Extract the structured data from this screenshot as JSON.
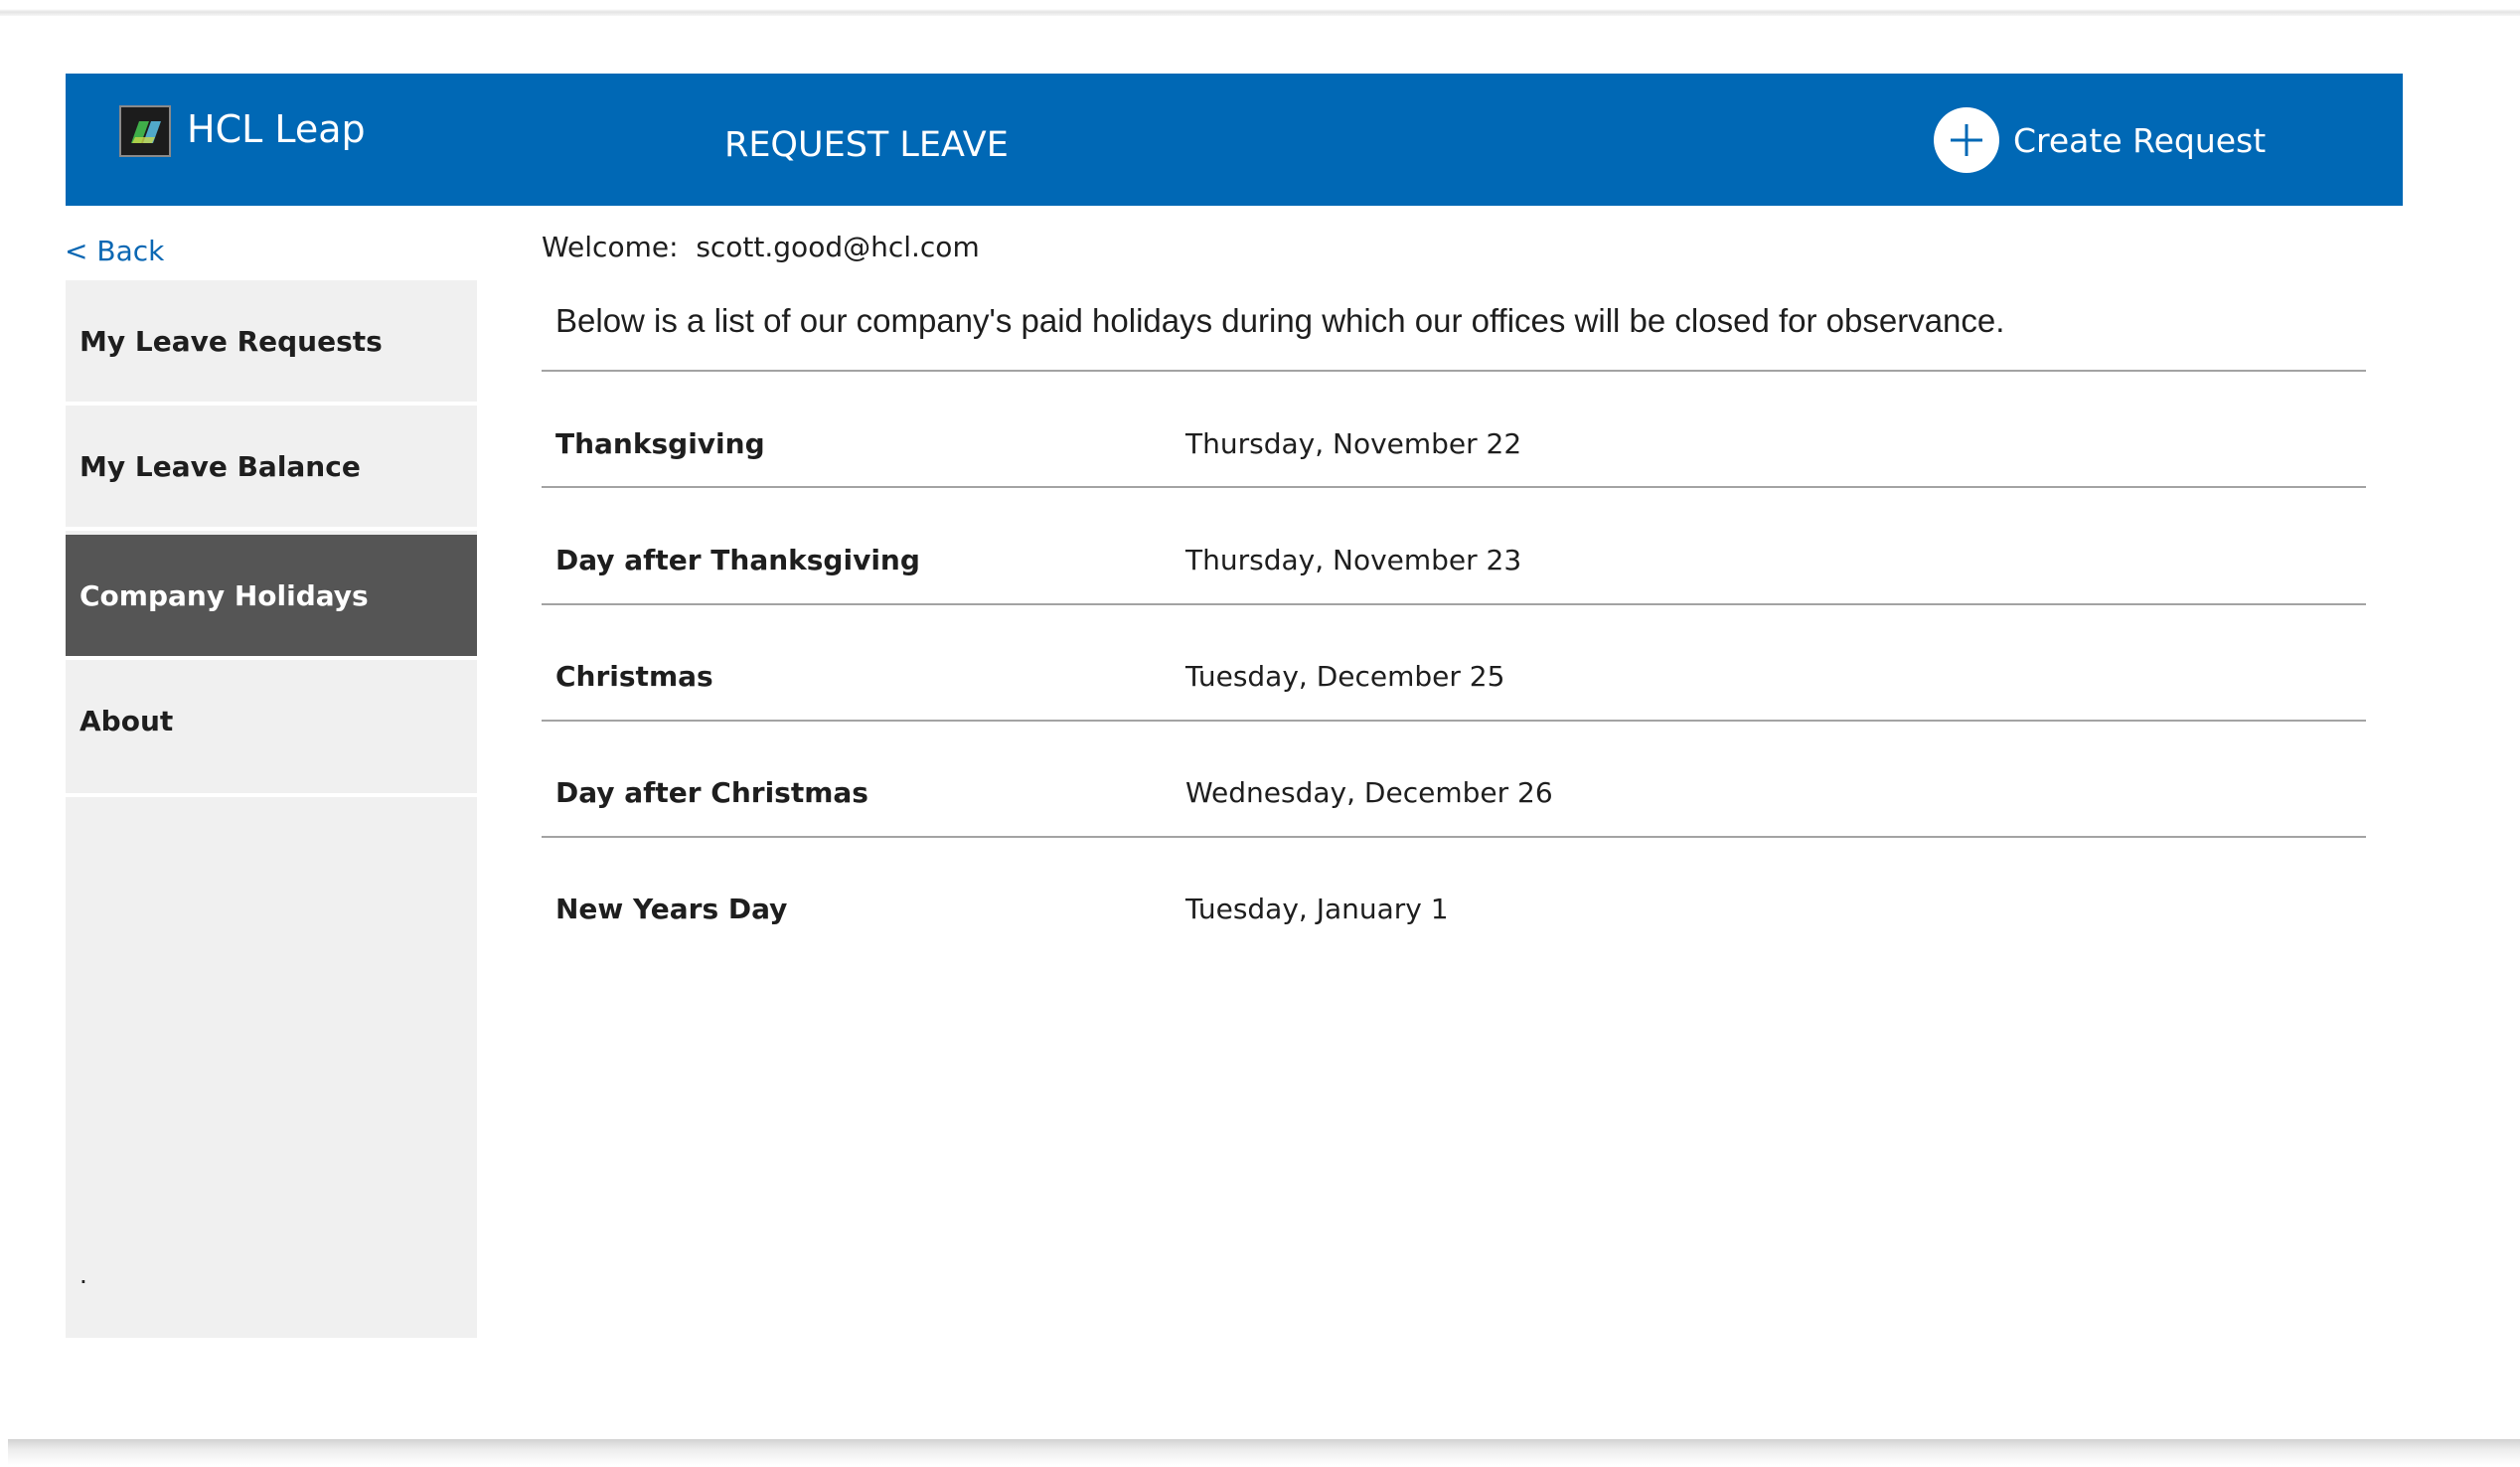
{
  "header": {
    "brand": "HCL Leap",
    "title": "REQUEST LEAVE",
    "create_label": "Create Request",
    "background_color": "#0068b5"
  },
  "nav": {
    "back_label": "< Back",
    "items": [
      {
        "label": "My Leave Requests",
        "active": false
      },
      {
        "label": "My Leave Balance",
        "active": false
      },
      {
        "label": "Company Holidays",
        "active": true
      },
      {
        "label": "About",
        "active": false
      }
    ],
    "footer_text": "."
  },
  "main": {
    "welcome": "Welcome:  scott.good@hcl.com",
    "intro": "Below is a list of our company's paid holidays during which our offices will be closed for observance.",
    "holidays": [
      {
        "name": "Thanksgiving",
        "date": "Thursday, November 22"
      },
      {
        "name": "Day after Thanksgiving",
        "date": "Thursday, November 23"
      },
      {
        "name": "Christmas",
        "date": "Tuesday, December 25"
      },
      {
        "name": "Day after Christmas",
        "date": "Wednesday, December 26"
      },
      {
        "name": "New Years Day",
        "date": "Tuesday, January 1"
      }
    ]
  },
  "icons": {
    "logo": "hcl-leap-logo-icon",
    "create": "plus-circle-icon"
  }
}
